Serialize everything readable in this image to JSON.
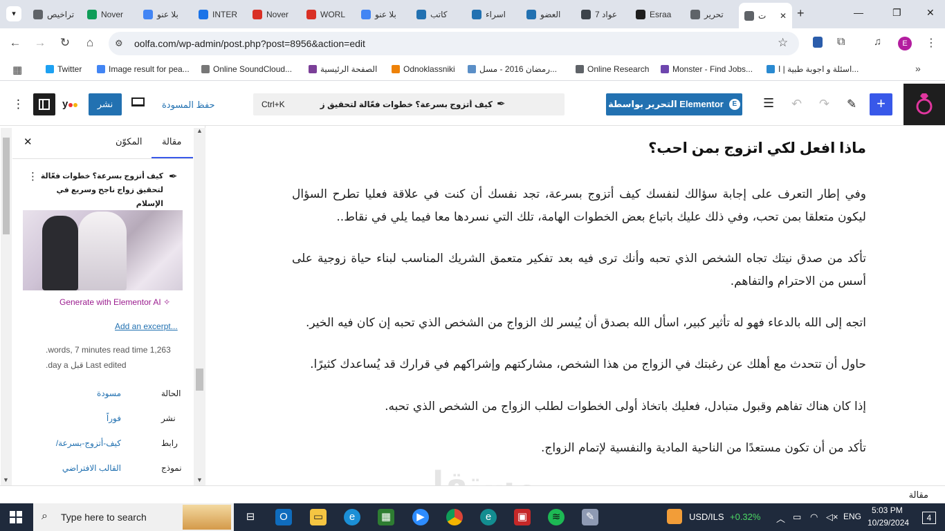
{
  "browser": {
    "tabs": [
      {
        "label": "تراخيص",
        "color": "#5f6368"
      },
      {
        "label": "Nover",
        "color": "#0f9d58"
      },
      {
        "label": "بلا عنو",
        "color": "#4285f4"
      },
      {
        "label": "INTER",
        "color": "#1a73e8"
      },
      {
        "label": "Nover",
        "color": "#d93025"
      },
      {
        "label": "WORL",
        "color": "#d93025"
      },
      {
        "label": "بلا عنو",
        "color": "#4285f4"
      },
      {
        "label": "كاتب",
        "color": "#2271b1"
      },
      {
        "label": "اسراء",
        "color": "#2271b1"
      },
      {
        "label": "العضو",
        "color": "#2271b1"
      },
      {
        "label": "7 عواد",
        "color": "#3c434a"
      },
      {
        "label": "Esraa",
        "color": "#1e1e1e"
      },
      {
        "label": "تحرير",
        "color": "#5f6368"
      },
      {
        "label": "ت",
        "color": "#5f6368"
      }
    ],
    "url": "oolfa.com/wp-admin/post.php?post=8956&action=edit",
    "bookmarks": [
      {
        "label": "Twitter",
        "color": "#1da1f2"
      },
      {
        "label": "Image result for pea...",
        "color": "#4285f4"
      },
      {
        "label": "Online SoundCloud...",
        "color": "#777777"
      },
      {
        "label": "الصفحة الرئيسية",
        "color": "#7b3f98"
      },
      {
        "label": "Odnoklassniki",
        "color": "#ee8208"
      },
      {
        "label": "رمضان 2016 - مسل...",
        "color": "#5b8fc7"
      },
      {
        "label": "Online Research",
        "color": "#5f6368"
      },
      {
        "label": "Monster - Find Jobs...",
        "color": "#6e46ae"
      },
      {
        "label": "اسئلة و اجوبة طبية | ا...",
        "color": "#2a8ad1"
      }
    ],
    "profile_initial": "E"
  },
  "editor": {
    "publish_label": "نشر",
    "save_draft_label": "حفظ المسودة",
    "command_shortcut": "Ctrl+K",
    "command_title": "كيف أتزوج بسرعة؟ خطوات فعّالة لتحقيق زواج ناجح و...",
    "elementor_label": "التحرير بواسطة Elementor"
  },
  "sidebar": {
    "tab_post": "مقالة",
    "tab_block": "المكوّن",
    "post_title": "كيف أتزوج بسرعة؟ خطوات فعّالة لتحقيق زواج ناجح وسريع في الإسلام",
    "generate_ai": "Generate with Elementor AI",
    "add_excerpt": "Add an excerpt...",
    "stats_line1": "1,263 words, 7 minutes read time.",
    "stats_line2": "Last edited قبل day a.",
    "rows": [
      {
        "label": "الحالة",
        "value": "مسودة"
      },
      {
        "label": "نشر",
        "value": "فوراً"
      },
      {
        "label": "رابط",
        "value": "/كيف-أتزوج-بسرعة"
      },
      {
        "label": "نموذج",
        "value": "القالب الافتراضي"
      }
    ]
  },
  "content": {
    "heading": "ماذا افعل لكي اتزوج بمن احب؟",
    "paragraphs": [
      "وفي إطار التعرف على إجابة سؤالك لنفسك كيف أتزوج بسرعة، تجد نفسك أن كنت في علاقة فعليا تطرح السؤال ليكون متعلقا بمن تحب، وفي ذلك عليك باتباع بعض الخطوات الهامة، تلك التي نسردها معا فيما يلي في نقاط..",
      "تأكد من صدق نيتك تجاه الشخص الذي تحبه وأنك ترى فيه بعد تفكير متعمق الشريك المناسب لبناء حياة زوجية على أسس من الاحترام والتفاهم.",
      "اتجه إلى الله بالدعاء فهو له تأثير كبير، اسأل الله بصدق أن يُيسر لك الزواج من الشخص الذي تحبه إن كان فيه الخير.",
      "حاول أن تتحدث مع أهلك عن رغبتك في الزواج من هذا الشخص، مشاركتهم وإشراكهم في قرارك قد يُساعدك كثيرًا.",
      "إذا كان هناك تفاهم وقبول متبادل، فعليك باتخاذ أولى الخطوات لطلب الزواج من الشخص الذي تحبه.",
      "تأكد من أن تكون مستعدًا من الناحية المادية والنفسية لإتمام الزواج."
    ]
  },
  "footer": {
    "breadcrumb": "مقالة"
  },
  "taskbar": {
    "search_placeholder": "Type here to search",
    "currency": "USD/ILS",
    "currency_change": "+0.32%",
    "language": "ENG",
    "time": "5:03 PM",
    "date": "10/29/2024",
    "notifications": "4"
  },
  "watermark": "مستقل"
}
